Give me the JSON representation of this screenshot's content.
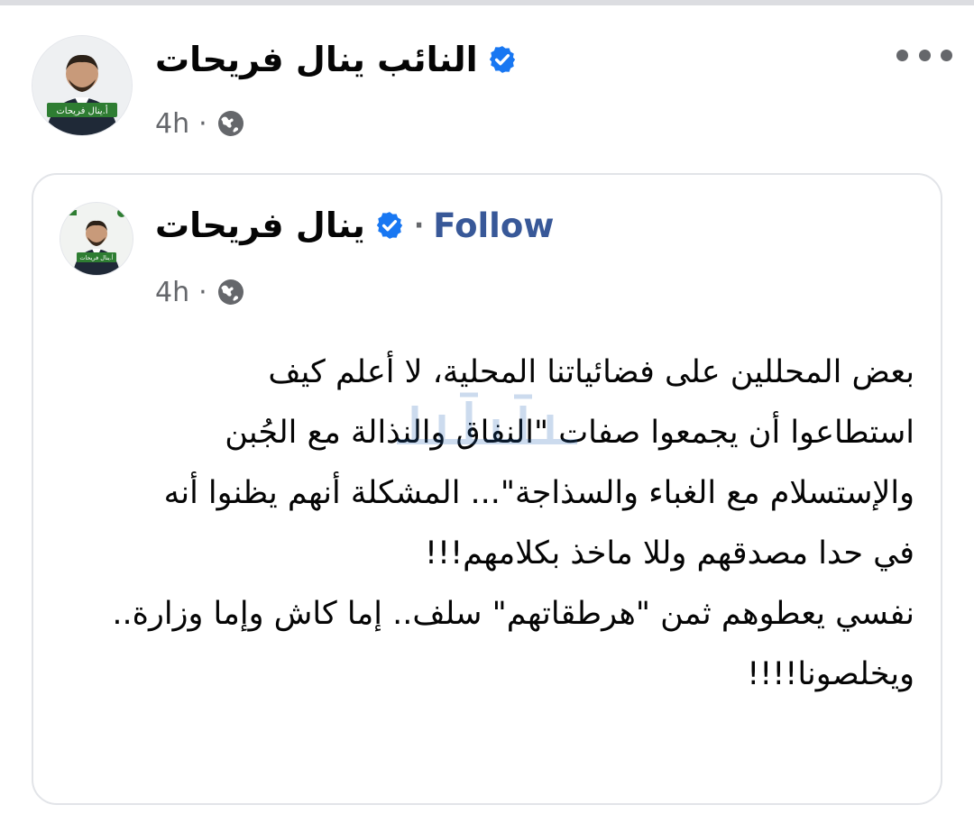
{
  "outer_post": {
    "author_name": "النائب ينال فريحات",
    "timestamp": "4h",
    "avatar_badge_text": "أ.ينال فريحات",
    "more_icon": "more-horizontal-icon",
    "privacy_icon": "globe-icon"
  },
  "shared_post": {
    "author_name": "ينال فريحات",
    "separator": "·",
    "follow_label": "Follow",
    "timestamp": "4h",
    "avatar_badge_text": "أ.ينال فريحات",
    "privacy_icon": "globe-icon",
    "body_lines": [
      "بعض المحللين على فضائياتنا المحلية، لا أعلم كيف",
      "استطاعوا أن يجمعوا صفات \"النفاق والنذالة مع الجُبن",
      "والإستسلام مع الغباء والسذاجة\"... المشكلة أنهم يظنوا أنه",
      "في حدا مصدقهم وللا ماخذ بكلامهم!!!",
      "نفسي يعطوهم ثمن \"هرطقاتهم\" سلف.. إما كاش وإما وزارة..",
      "ويخلصونا!!!!"
    ]
  },
  "colors": {
    "verified_blue": "#1877f2",
    "follow_blue": "#385898",
    "meta_gray": "#65676b",
    "badge_green": "#2e7d32"
  }
}
